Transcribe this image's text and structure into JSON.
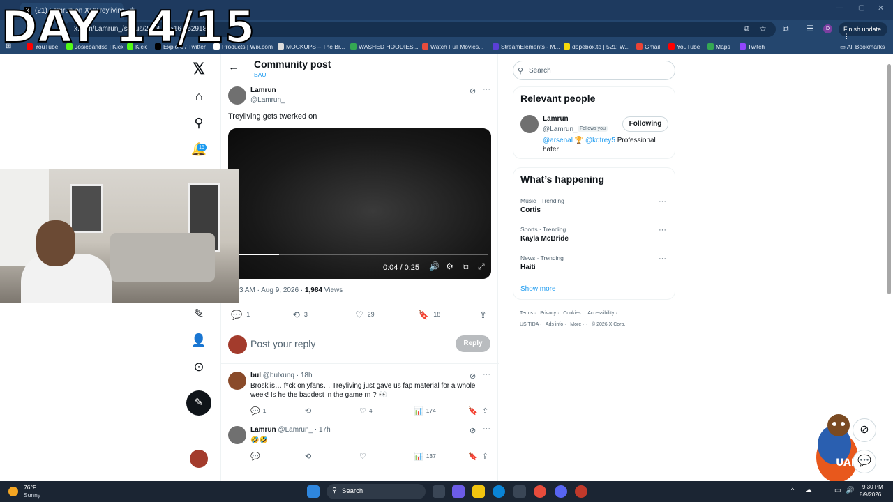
{
  "overlay": {
    "day_text": "DAY 14/15"
  },
  "browser": {
    "tab_title": "(21) Lamrun on X: \"Treyliving g",
    "url": "x.com/Lamrun_/status/2084...5516...62918",
    "finish_update": "Finish update",
    "bookmarks": [
      {
        "label": "YouTube",
        "icon": "youtube-icon",
        "color": "#ff0000"
      },
      {
        "label": "Josiebandss | Kick",
        "icon": "kick-icon",
        "color": "#53fc18"
      },
      {
        "label": "Kick",
        "icon": "kick-icon",
        "color": "#53fc18"
      },
      {
        "label": "Explore / Twitter",
        "icon": "x-icon",
        "color": "#000000"
      },
      {
        "label": "Products | Wix.com",
        "icon": "wix-icon",
        "color": "#ffffff"
      },
      {
        "label": "MOCKUPS – The Br...",
        "icon": "globe-icon",
        "color": "#dddddd"
      },
      {
        "label": "WASHED HOODIES...",
        "icon": "drive-icon",
        "color": "#34a853"
      },
      {
        "label": "Watch Full Movies...",
        "icon": "folder-icon",
        "color": "#e84c3d"
      },
      {
        "label": "StreamElements - M...",
        "icon": "streamelements-icon",
        "color": "#5a3fd6"
      },
      {
        "label": "dopebox.to | 521: W...",
        "icon": "dopebox-icon",
        "color": "#f5d90a"
      },
      {
        "label": "Gmail",
        "icon": "gmail-icon",
        "color": "#ea4335"
      },
      {
        "label": "YouTube",
        "icon": "youtube-icon",
        "color": "#ff0000"
      },
      {
        "label": "Maps",
        "icon": "maps-icon",
        "color": "#34a853"
      },
      {
        "label": "Twitch",
        "icon": "twitch-icon",
        "color": "#9146ff"
      }
    ],
    "all_bookmarks": "All Bookmarks"
  },
  "nav": {
    "notification_count": "15"
  },
  "header": {
    "title": "Community post",
    "subtitle": "BAU"
  },
  "post": {
    "name": "Lamrun",
    "handle": "@Lamrun_",
    "text": "Treyliving gets twerked on",
    "video_time": "0:04 / 0:25",
    "video_progress": 0.16,
    "time_partial": "3 AM · Aug 9, 2026 · ",
    "views_count": "1,984",
    "views_label": " Views",
    "replies": "1",
    "reposts": "3",
    "likes": "29",
    "bookmarks": "18"
  },
  "reply_box": {
    "placeholder": "Post your reply",
    "button": "Reply"
  },
  "comments": [
    {
      "name": "bul",
      "meta": "@bulxunq · 18h",
      "text": "Broskiis… f*ck onlyfans… Treyliving just gave us fap material for a whole week! Is he the baddest in the game rn ? 👀",
      "replies": "1",
      "reposts": "",
      "likes": "4",
      "views": "174"
    },
    {
      "name": "Lamrun",
      "meta": "@Lamrun_ · 17h",
      "text": "🤣🤣",
      "replies": "",
      "reposts": "",
      "likes": "",
      "views": "137"
    }
  ],
  "sidebar": {
    "search_placeholder": "Search",
    "relevant_title": "Relevant people",
    "person": {
      "name": "Lamrun",
      "handle": "@Lamrun_",
      "follows_you": "Follows you",
      "follow_button": "Following",
      "bio_link1": "@arsenal",
      "bio_emoji": " 🏆 ",
      "bio_link2": "@kdtrey5",
      "bio_rest": " Professional hater"
    },
    "happening_title": "What’s happening",
    "trends": [
      {
        "category": "Music · Trending",
        "name": "Cortis"
      },
      {
        "category": "Sports · Trending",
        "name": "Kayla McBride"
      },
      {
        "category": "News · Trending",
        "name": "Haiti"
      }
    ],
    "show_more": "Show more",
    "footer_row1": [
      "Terms",
      "Privacy",
      "Cookies",
      "Accessibility"
    ],
    "footer_row2": [
      "US TIDA",
      "Ads info",
      "More ···",
      "© 2026 X Corp."
    ]
  },
  "taskbar": {
    "temp": "76°F",
    "weather": "Sunny",
    "search": "Search",
    "time": "9:30 PM",
    "date": "8/9/2026"
  }
}
